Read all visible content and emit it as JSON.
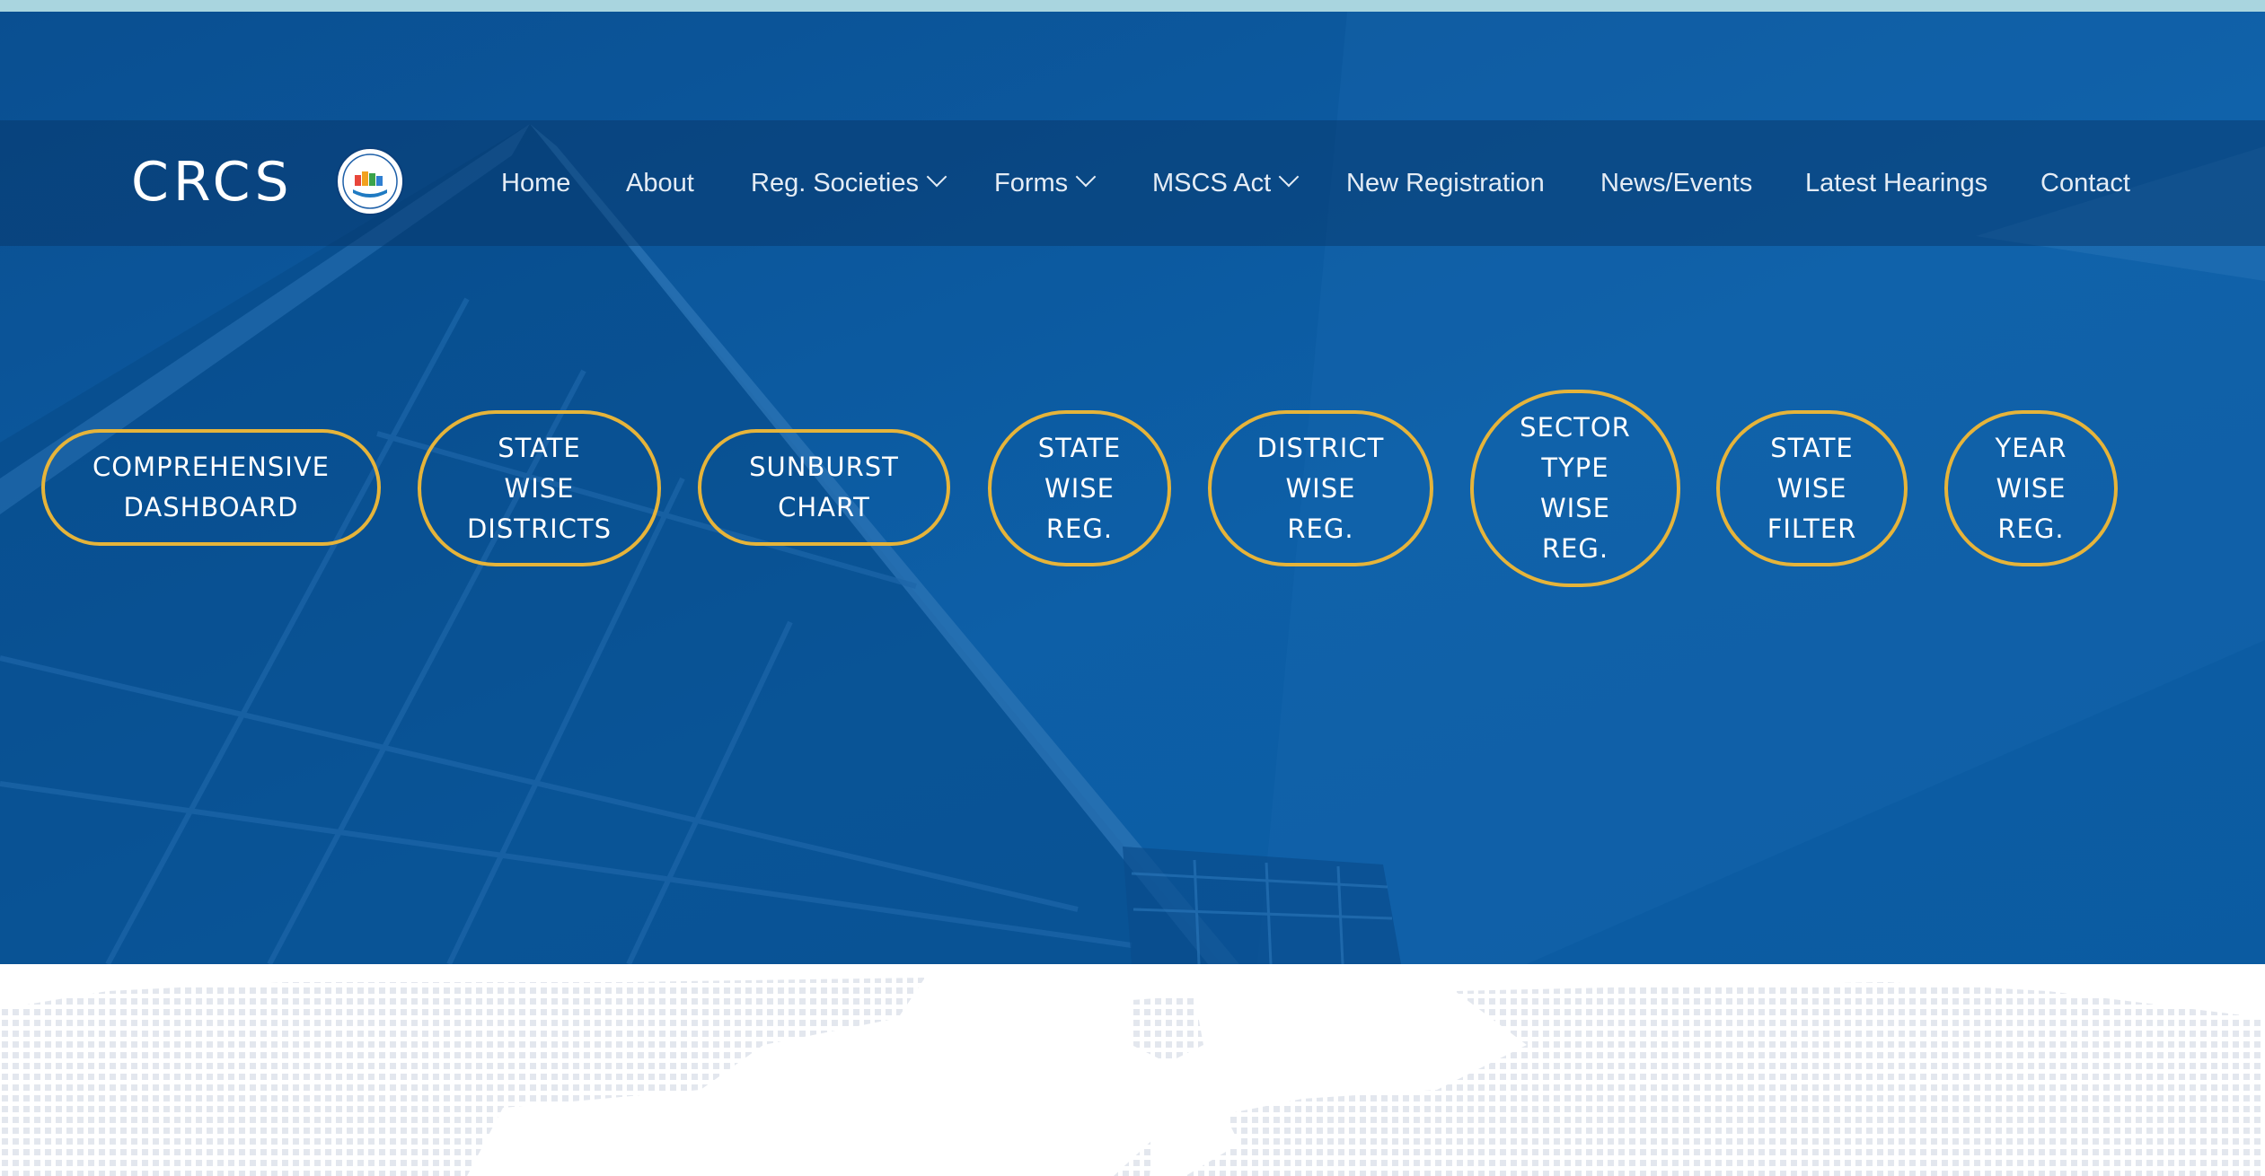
{
  "brand": {
    "name": "CRCS",
    "logo_icon": "crcs-emblem-icon"
  },
  "nav": [
    {
      "label": "Home",
      "dropdown": false
    },
    {
      "label": "About",
      "dropdown": false
    },
    {
      "label": "Reg. Societies",
      "dropdown": true
    },
    {
      "label": "Forms",
      "dropdown": true
    },
    {
      "label": "MSCS Act",
      "dropdown": true
    },
    {
      "label": "New Registration",
      "dropdown": false
    },
    {
      "label": "News/Events",
      "dropdown": false
    },
    {
      "label": "Latest Hearings",
      "dropdown": false
    },
    {
      "label": "Contact",
      "dropdown": false
    }
  ],
  "buttons": [
    {
      "label": "COMPREHENSIVE\nDASHBOARD"
    },
    {
      "label": "STATE\nWISE\nDISTRICTS"
    },
    {
      "label": "SUNBURST\nCHART"
    },
    {
      "label": "STATE\nWISE\nREG."
    },
    {
      "label": "DISTRICT\nWISE\nREG."
    },
    {
      "label": "SECTOR\nTYPE\nWISE\nREG."
    },
    {
      "label": "STATE\nWISE\nFILTER"
    },
    {
      "label": "YEAR\nWISE\nREG."
    }
  ],
  "colors": {
    "hero_blue": "#08559a",
    "accent_gold": "#e6b43a",
    "top_strip": "#a9d5df"
  }
}
